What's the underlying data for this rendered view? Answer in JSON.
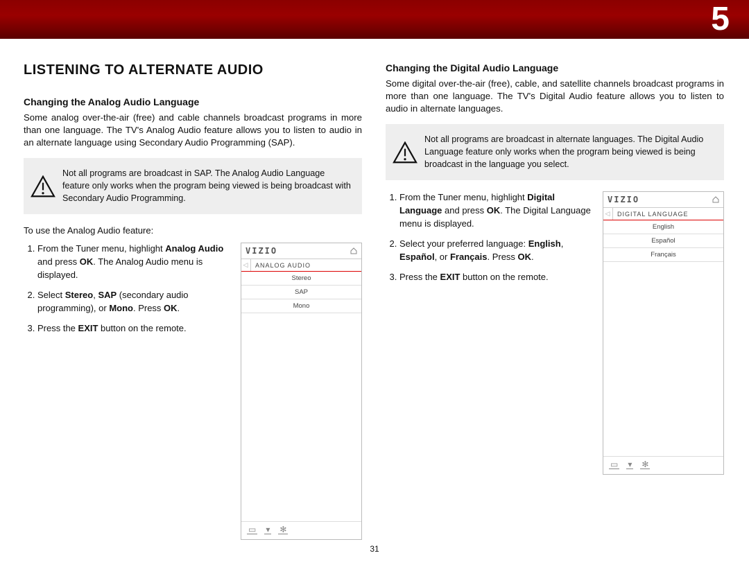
{
  "chapter_number": "5",
  "page_number": "31",
  "headline": "LISTENING TO ALTERNATE AUDIO",
  "analog": {
    "heading": "Changing the Analog Audio Language",
    "intro": "Some analog over-the-air (free) and cable channels broadcast programs in more than one language. The TV's Analog Audio feature allows you to listen to audio in an alternate language using Secondary Audio Programming (SAP).",
    "note": "Not all programs are broadcast in SAP. The Analog Audio Language feature only works when the program being viewed is being broadcast with Secondary Audio Programming.",
    "lead": "To use the Analog Audio feature:",
    "steps": {
      "s1a": "From the Tuner menu, highlight ",
      "s1b": "Analog Audio",
      "s1c": " and press ",
      "s1d": "OK",
      "s1e": ". The Analog Audio menu is displayed.",
      "s2a": "Select ",
      "s2b": "Stereo",
      "s2c": ", ",
      "s2d": "SAP",
      "s2e": " (secondary audio programming), or ",
      "s2f": "Mono",
      "s2g": ". Press ",
      "s2h": "OK",
      "s2i": ".",
      "s3a": "Press the ",
      "s3b": "EXIT",
      "s3c": " button on the remote."
    },
    "menu_brand": "VIZIO",
    "menu_title": "ANALOG AUDIO",
    "menu_options": [
      "Stereo",
      "SAP",
      "Mono"
    ]
  },
  "digital": {
    "heading": "Changing the Digital Audio Language",
    "intro": "Some digital over-the-air (free), cable, and satellite channels broadcast programs in more than one language. The TV's Digital Audio feature allows you to listen to audio in alternate languages.",
    "note": "Not all programs are broadcast in alternate languages. The Digital Audio Language feature only works when the program being viewed is being broadcast in the language you select.",
    "steps": {
      "s1a": "From the Tuner menu, highlight ",
      "s1b": "Digital Language",
      "s1c": " and press ",
      "s1d": "OK",
      "s1e": ". The Digital Language menu is displayed.",
      "s2a": "Select your preferred language: ",
      "s2b": "English",
      "s2c": ", ",
      "s2d": "Español",
      "s2e": ", or ",
      "s2f": "Français",
      "s2g": ". Press ",
      "s2h": "OK",
      "s2i": ".",
      "s3a": "Press the ",
      "s3b": "EXIT",
      "s3c": " button on the remote."
    },
    "menu_brand": "VIZIO",
    "menu_title": "DIGITAL LANGUAGE",
    "menu_options": [
      "English",
      "Español",
      "Français"
    ]
  }
}
